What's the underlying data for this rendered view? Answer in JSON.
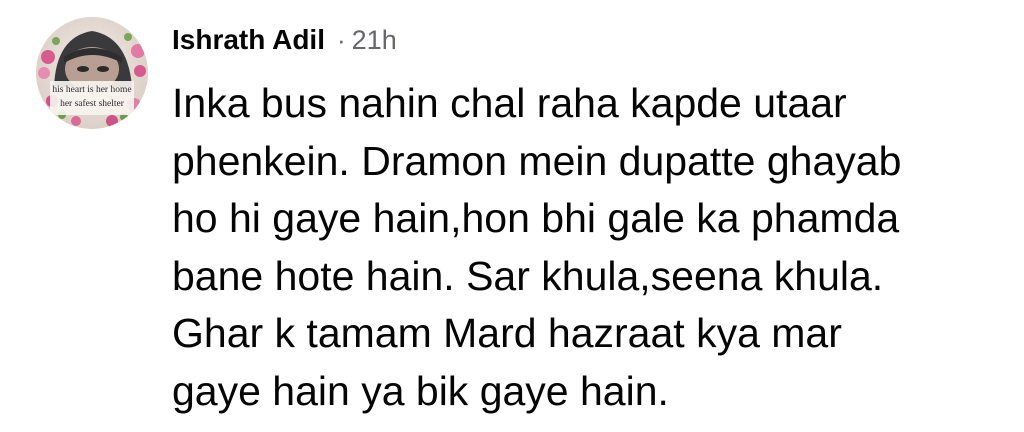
{
  "comment": {
    "author": "Ishrath Adil",
    "separator": "·",
    "timestamp": "21h",
    "avatar": {
      "caption": "his heart is her home\nher safest shelter",
      "icon": "profile-photo"
    },
    "text": "Inka bus nahin chal raha kapde utaar\nphenkein. Dramon mein dupatte ghayab\nho hi gaye hain,hon bhi gale ka phamda\nbane hote hain. Sar khula,seena khula.\nGhar k tamam Mard hazraat kya mar\ngaye hain ya bik gaye hain."
  },
  "colors": {
    "text": "#050505",
    "meta": "#65676b",
    "background": "#ffffff"
  }
}
